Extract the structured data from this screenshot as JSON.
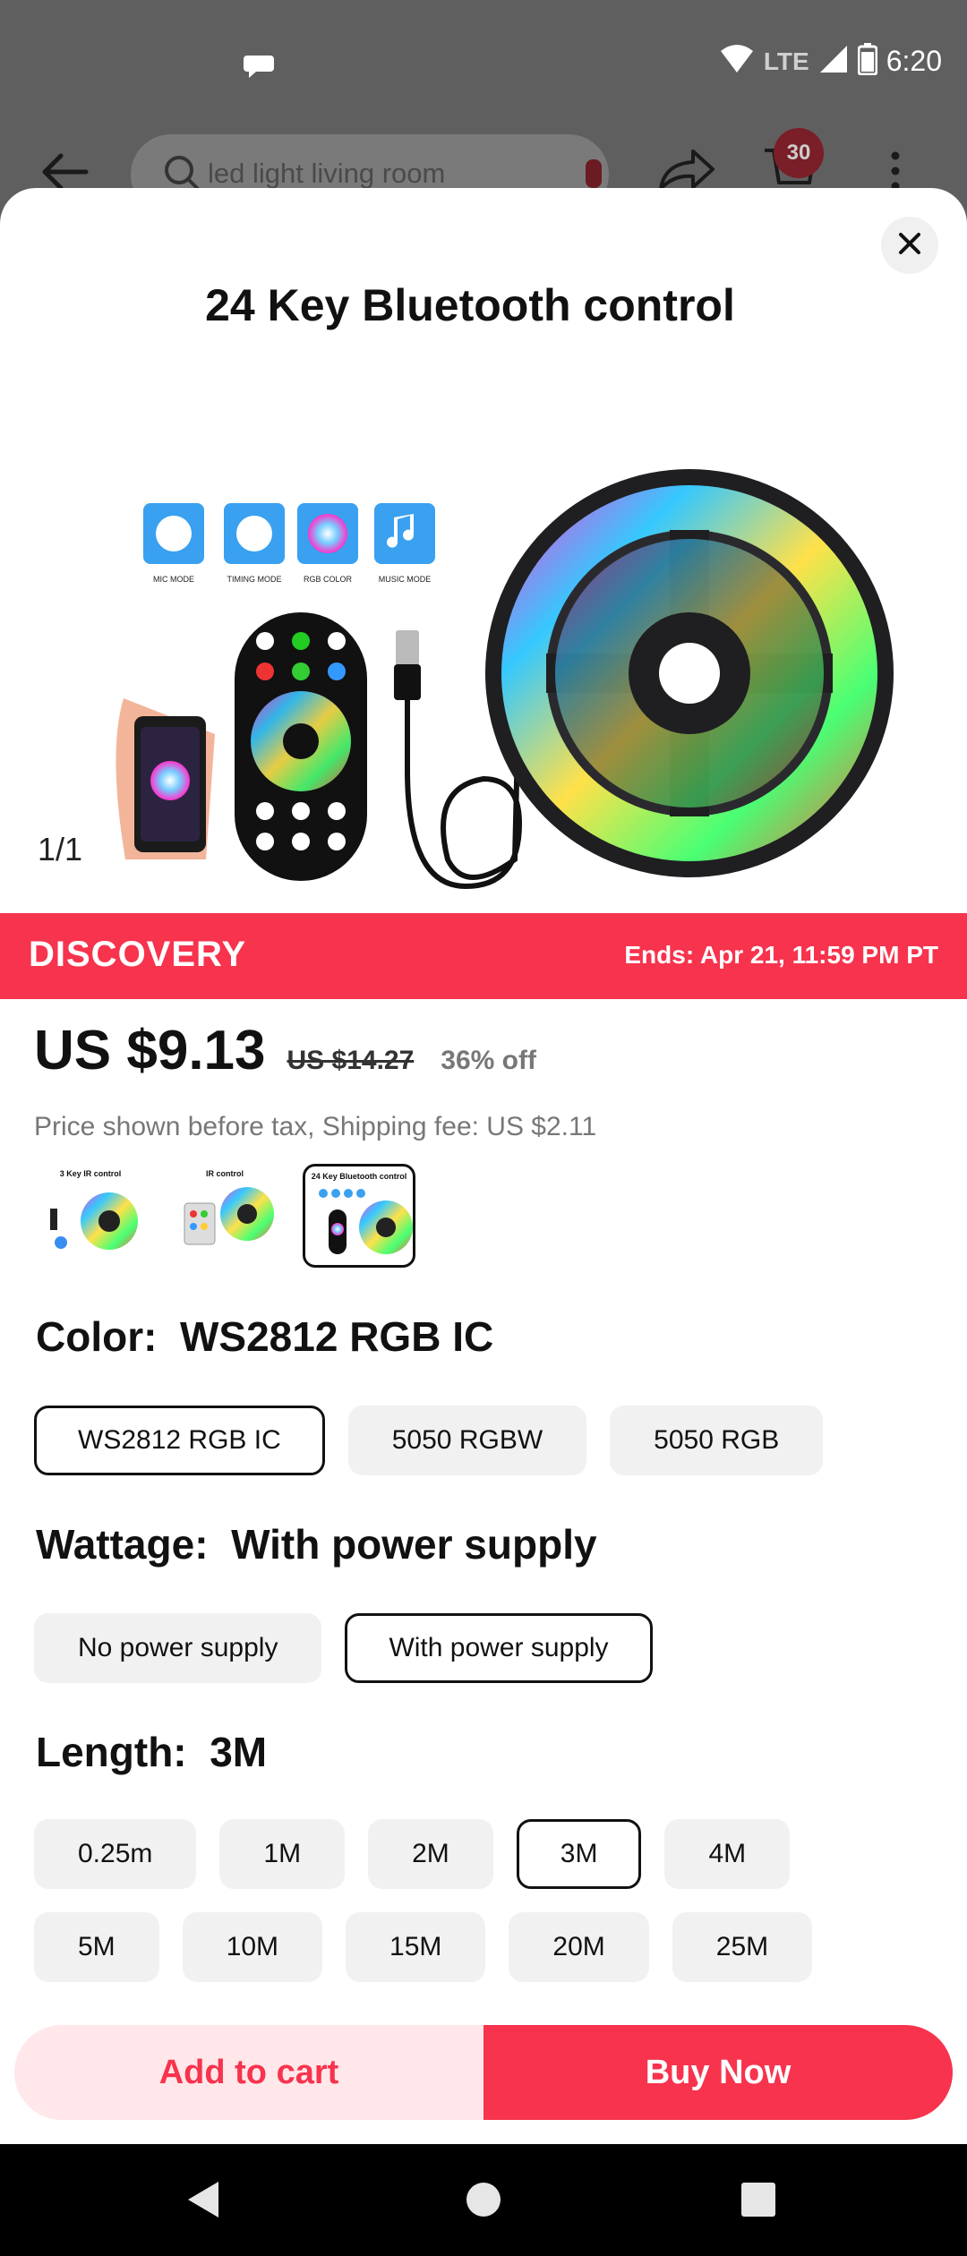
{
  "status_bar": {
    "time": "6:20",
    "network": "LTE"
  },
  "header": {
    "search_text": "led light living room",
    "cart_count": "30"
  },
  "hero": {
    "title": "24 Key Bluetooth control",
    "counter": "1/1",
    "modes": [
      "MIC MODE",
      "TIMING MODE",
      "RGB COLOR",
      "MUSIC MODE"
    ]
  },
  "promo": {
    "brand": "DISCOVERY",
    "ends": "Ends: Apr 21, 11:59 PM PT"
  },
  "price": {
    "current": "US $9.13",
    "original": "US $14.27",
    "discount": "36% off",
    "note": "Price shown before tax, Shipping fee: US $2.11"
  },
  "thumbnails": [
    {
      "caption": "3 Key IR control"
    },
    {
      "caption": "IR control"
    },
    {
      "caption": "24 Key Bluetooth control",
      "selected": true
    }
  ],
  "color": {
    "label": "Color:",
    "value": "WS2812 RGB IC",
    "options": [
      "WS2812 RGB IC",
      "5050 RGBW",
      "5050 RGB"
    ],
    "selected": "WS2812 RGB IC"
  },
  "wattage": {
    "label": "Wattage:",
    "value": "With power supply",
    "options": [
      "No power supply",
      "With power supply"
    ],
    "selected": "With power supply"
  },
  "length": {
    "label": "Length:",
    "value": "3M",
    "options_row1": [
      "0.25m",
      "1M",
      "2M",
      "3M",
      "4M"
    ],
    "options_row2": [
      "5M",
      "10M",
      "15M",
      "20M",
      "25M"
    ],
    "selected": "3M"
  },
  "actions": {
    "add_to_cart": "Add to cart",
    "buy_now": "Buy Now"
  },
  "colors": {
    "accent": "#f7334d",
    "accent_light": "#ffe7ea"
  }
}
